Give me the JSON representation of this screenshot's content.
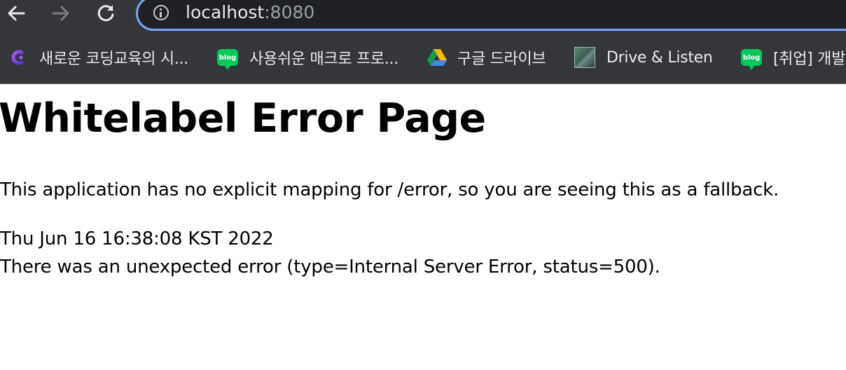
{
  "browser": {
    "url_host": "localhost",
    "url_port": ":8080",
    "bookmarks": [
      {
        "label": "새로운 코딩교육의 시...",
        "icon": "coding-c-icon"
      },
      {
        "label": "사용쉬운 매크로 프로...",
        "icon": "naver-blog-icon"
      },
      {
        "label": "구글 드라이브",
        "icon": "google-drive-icon"
      },
      {
        "label": "Drive & Listen",
        "icon": "drive-listen-icon"
      },
      {
        "label": "[취업] 개발",
        "icon": "naver-blog-icon"
      }
    ],
    "blog_icon_text": "blog",
    "accent_color": "#7ba3f6"
  },
  "page": {
    "title": "Whitelabel Error Page",
    "message": "This application has no explicit mapping for /error, so you are seeing this as a fallback.",
    "timestamp": "Thu Jun 16 16:38:08 KST 2022",
    "error_detail": "There was an unexpected error (type=Internal Server Error, status=500)."
  }
}
